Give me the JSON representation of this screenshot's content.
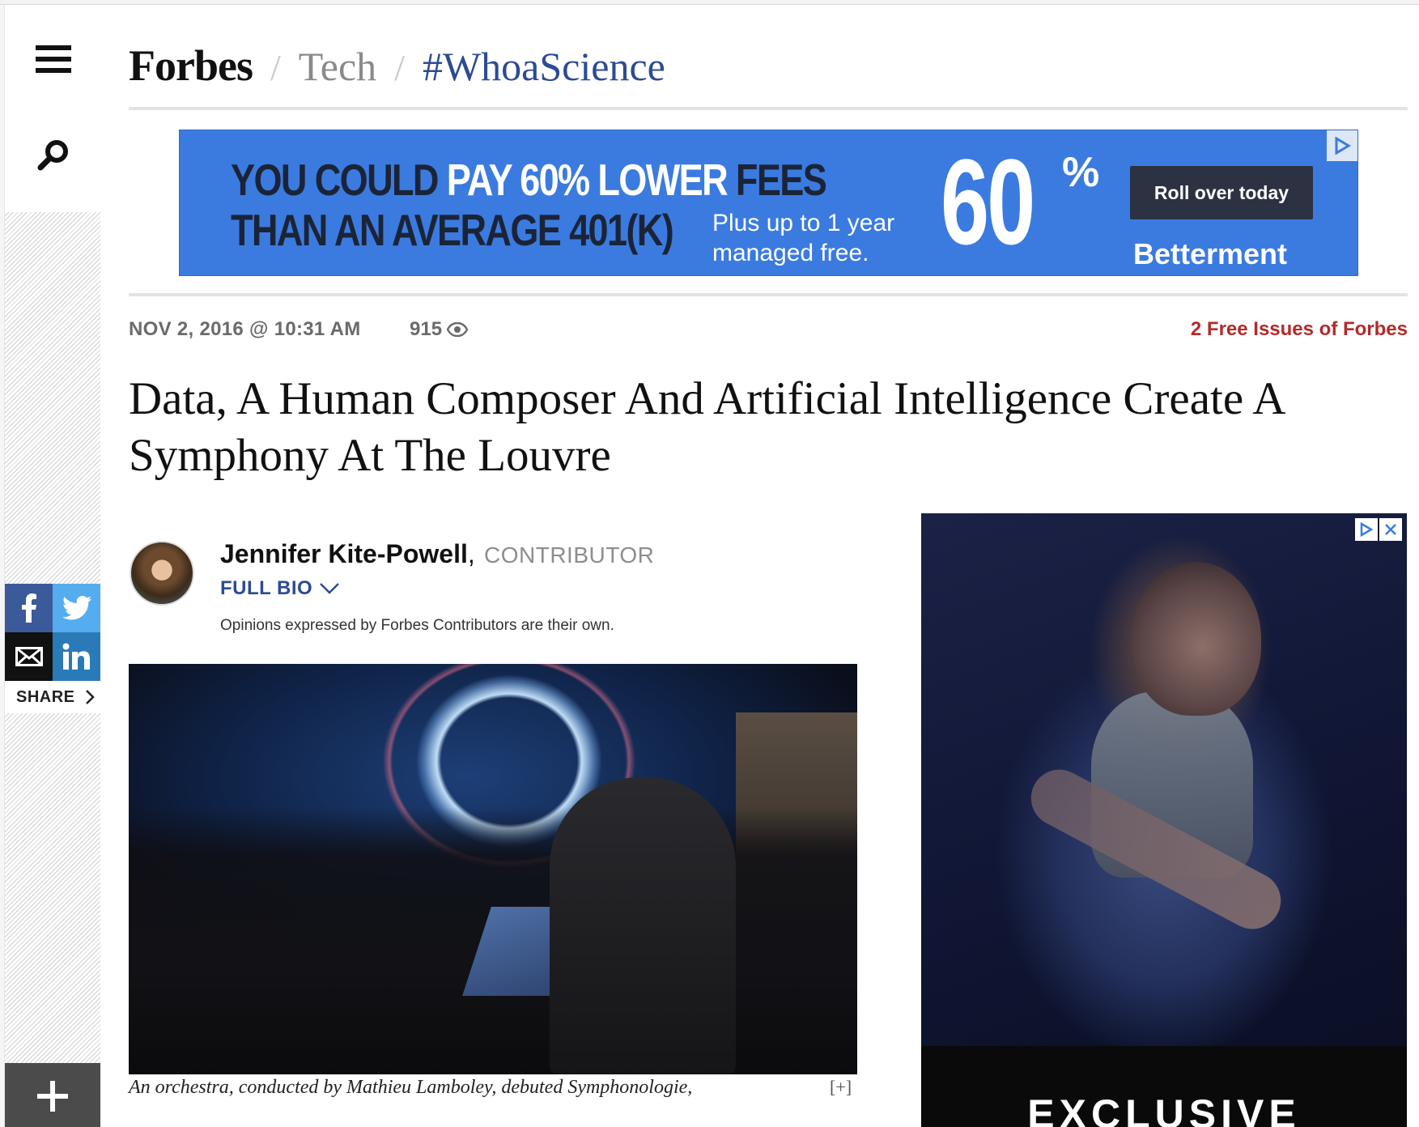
{
  "header": {
    "brand": "Forbes",
    "separator": "/",
    "section": "Tech",
    "channel": "#WhoaScience"
  },
  "sidebar": {
    "menu_icon": "hamburger-menu-icon",
    "search_icon": "search-icon",
    "share_label": "SHARE",
    "social": [
      "facebook",
      "twitter",
      "email",
      "linkedin"
    ],
    "plus_icon": "plus-icon"
  },
  "top_ad": {
    "line1_a": "YOU COULD ",
    "line1_b": "PAY 60% LOWER",
    "line1_c": " FEES",
    "line2": "THAN AN AVERAGE 401(K)",
    "sub_line1": "Plus up to 1 year",
    "sub_line2": "managed free.",
    "big_number": "60",
    "percent": "%",
    "cta": "Roll over today",
    "advertiser": "Betterment",
    "bg_color": "#3b7be0"
  },
  "article": {
    "date": "NOV 2, 2016 @ 10:31 AM",
    "views": "915",
    "promo": "2 Free Issues of Forbes",
    "headline": "Data, A Human Composer And Artificial Intelligence Create A Symphony At The Louvre",
    "author_name": "Jennifer Kite-Powell",
    "author_sep": ",",
    "author_role": "CONTRIBUTOR",
    "full_bio": "FULL BIO",
    "disclaimer": "Opinions expressed by Forbes Contributors are their own.",
    "caption": "An orchestra, conducted by Mathieu Lamboley, debuted Symphonologie,",
    "caption_toggle": "[+]"
  },
  "side_ad": {
    "banner_text": "EXCLUSIVE"
  },
  "colors": {
    "brand_blue": "#2c4b94",
    "promo_red": "#b42a2a"
  }
}
